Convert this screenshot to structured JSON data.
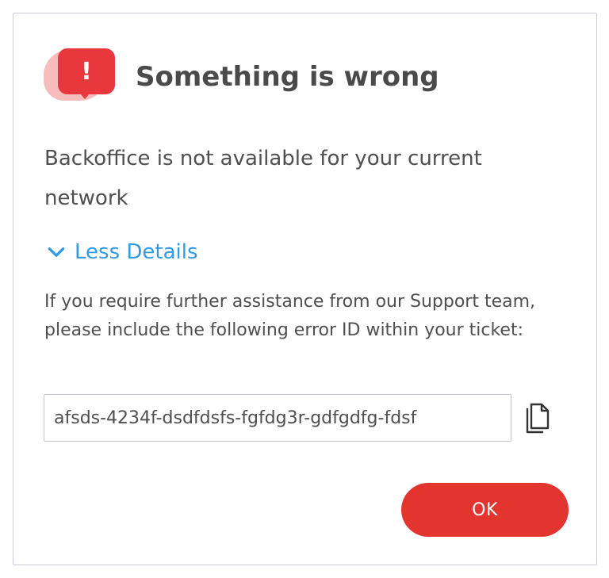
{
  "dialog": {
    "title": "Something is wrong",
    "message": "Backoffice is not available for your current network",
    "details_toggle_label": "Less Details",
    "help_text": "If you require further assistance from our Support team, please include the following error ID within your ticket:",
    "error_id": "afsds-4234f-dsdfdsfs-fgfdg3r-gdfgdfg-fdsf",
    "ok_label": "OK"
  },
  "icons": {
    "header": "error-speech-bubble-icon",
    "toggle": "chevron-down-icon",
    "copy": "copy-icon"
  },
  "colors": {
    "error_red": "#e8383d",
    "error_blob": "#f4a5a5",
    "link_blue": "#2e9be6",
    "button_red": "#e3342f",
    "text": "#4a4a4a",
    "border": "#c8ccd2"
  }
}
